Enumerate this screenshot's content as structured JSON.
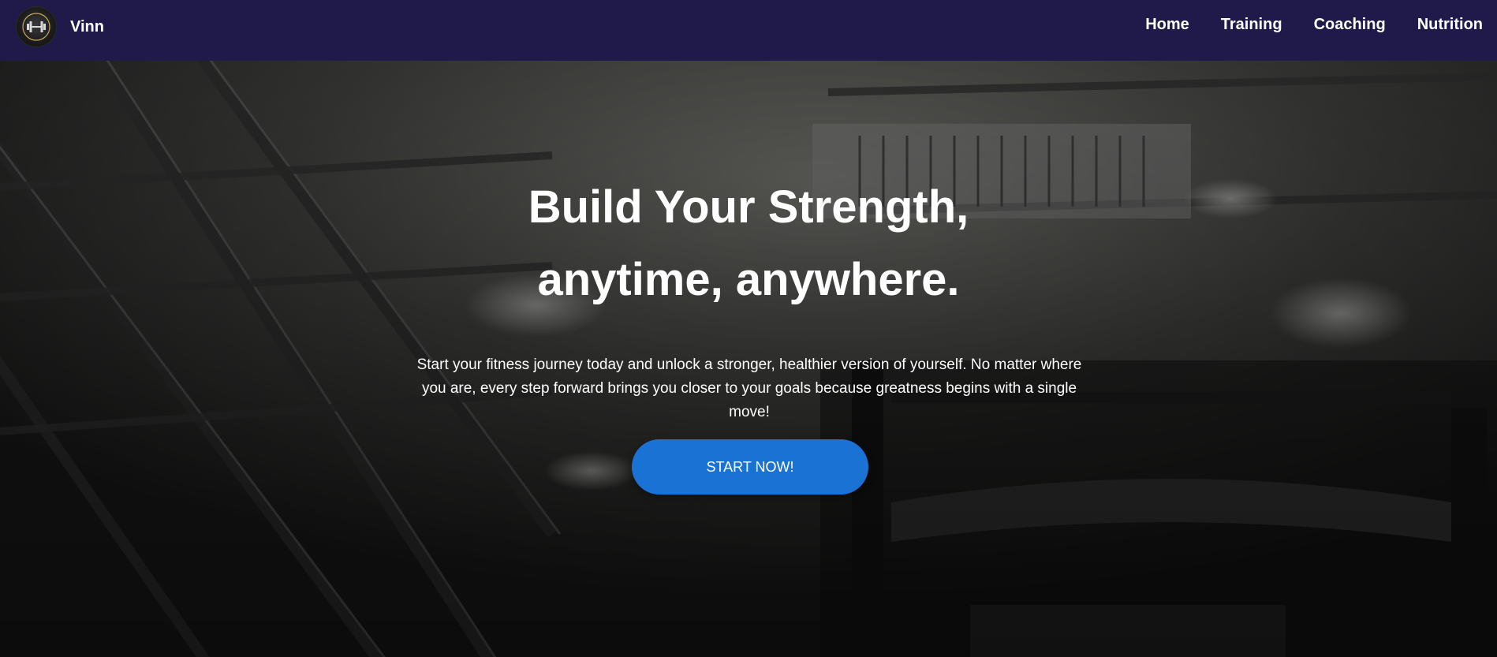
{
  "navbar": {
    "brand_name": "Vinn",
    "logo_icon": "dumbbell-logo-icon",
    "links": [
      {
        "label": "Home"
      },
      {
        "label": "Training"
      },
      {
        "label": "Coaching"
      },
      {
        "label": "Nutrition"
      }
    ],
    "background_color": "#201a4a"
  },
  "hero": {
    "title_line1": "Build Your Strength,",
    "title_line2": "anytime, anywhere.",
    "description": "Start your fitness journey today and unlock a stronger, healthier version of yourself. No matter where you are, every step forward brings you closer to your goals because greatness begins with a single move!",
    "cta_label": "START NOW!",
    "cta_color": "#1a73d4",
    "background": "gym-ceiling-photo"
  }
}
